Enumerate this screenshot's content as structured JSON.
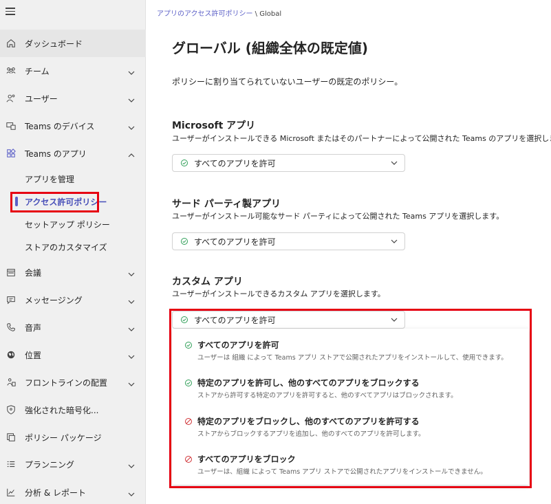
{
  "breadcrumb": {
    "link": "アプリのアクセス許可ポリシー",
    "separator": " \\ ",
    "current": "Global"
  },
  "sidebar": {
    "items": [
      {
        "label": "ダッシュボード",
        "icon": "home-icon"
      },
      {
        "label": "チーム",
        "icon": "teams-group-icon"
      },
      {
        "label": "ユーザー",
        "icon": "users-icon"
      },
      {
        "label": "Teams のデバイス",
        "icon": "devices-icon"
      },
      {
        "label": "Teams のアプリ",
        "icon": "apps-icon"
      },
      {
        "label": "会議",
        "icon": "calendar-icon"
      },
      {
        "label": "メッセージング",
        "icon": "chat-icon"
      },
      {
        "label": "音声",
        "icon": "phone-icon"
      },
      {
        "label": "位置",
        "icon": "globe-icon"
      },
      {
        "label": "フロントラインの配置",
        "icon": "frontline-icon"
      },
      {
        "label": "強化された暗号化...",
        "icon": "shield-icon"
      },
      {
        "label": "ポリシー パッケージ",
        "icon": "package-icon"
      },
      {
        "label": "プランニング",
        "icon": "list-icon"
      },
      {
        "label": "分析 & レポート",
        "icon": "chart-icon"
      }
    ],
    "sub_items": [
      {
        "label": "アプリを管理"
      },
      {
        "label": "アクセス許可ポリシー"
      },
      {
        "label": "セットアップ ポリシー"
      },
      {
        "label": "ストアのカスタマイズ"
      }
    ]
  },
  "main": {
    "title": "グローバル (組織全体の既定値)",
    "description": "ポリシーに割り当てられていないユーザーの既定のポリシー。",
    "sections": [
      {
        "title": "Microsoft アプリ",
        "description": "ユーザーがインストールできる Microsoft またはそのパートナーによって公開された Teams のアプリを選択します。",
        "value": "すべてのアプリを許可"
      },
      {
        "title": "サード パーティ製アプリ",
        "description": "ユーザーがインストール可能なサード パーティによって公開された Teams アプリを選択します。",
        "value": "すべてのアプリを許可"
      },
      {
        "title": "カスタム アプリ",
        "description": "ユーザーがインストールできるカスタム アプリを選択します。",
        "value": "すべてのアプリを許可"
      }
    ],
    "menu_options": [
      {
        "title": "すべてのアプリを許可",
        "description": "ユーザーは 組織 によって Teams アプリ ストアで公開されたアプリをインストールして、使用できます。",
        "icon": "check-circle-icon"
      },
      {
        "title": "特定のアプリを許可し、他のすべてのアプリをブロックする",
        "description": "ストアから許可する特定のアプリを許可すると、他のすべてアプリはブロックされます。",
        "icon": "check-circle-icon"
      },
      {
        "title": "特定のアプリをブロックし、他のすべてのアプリを許可する",
        "description": "ストアからブロックするアプリを追加し、他のすべてのアプリを許可します。",
        "icon": "block-icon"
      },
      {
        "title": "すべてのアプリをブロック",
        "description": "ユーザーは、組織 によって Teams アプリ ストアで公開されたアプリをインストールできません。",
        "icon": "block-icon"
      }
    ]
  },
  "colors": {
    "accent": "#5b5fc7",
    "highlight": "#e60012",
    "allow": "#2e9e57",
    "block": "#d13438"
  }
}
